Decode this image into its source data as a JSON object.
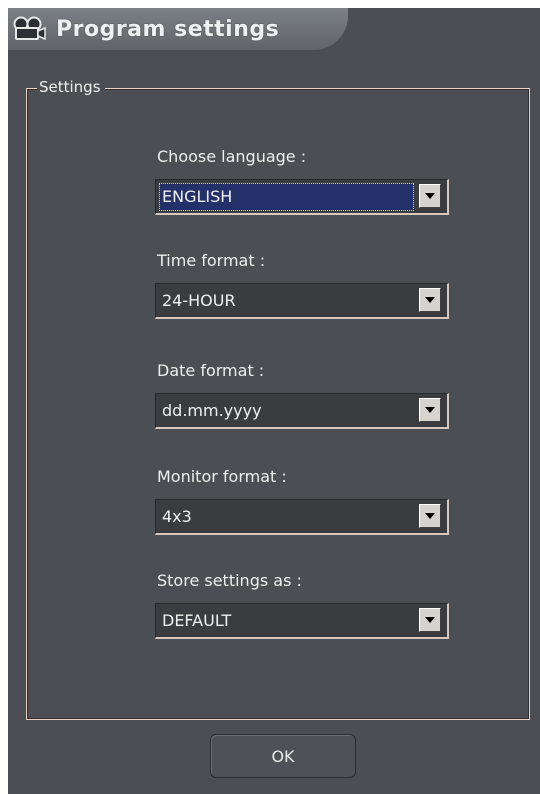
{
  "window": {
    "title": "Program settings",
    "title_icon": "camera-icon"
  },
  "settings": {
    "legend": "Settings",
    "fields": [
      {
        "label": "Choose language :",
        "value": "ENGLISH"
      },
      {
        "label": "Time format :",
        "value": "24-HOUR"
      },
      {
        "label": "Date format :",
        "value": "dd.mm.yyyy"
      },
      {
        "label": "Monitor format :",
        "value": "4x3"
      },
      {
        "label": "Store settings as :",
        "value": "DEFAULT"
      }
    ]
  },
  "buttons": {
    "ok": "OK"
  },
  "colors": {
    "background": "#4b4e52",
    "frame": "#efcfbd",
    "selection": "#24306a",
    "text": "#eeeeee"
  }
}
